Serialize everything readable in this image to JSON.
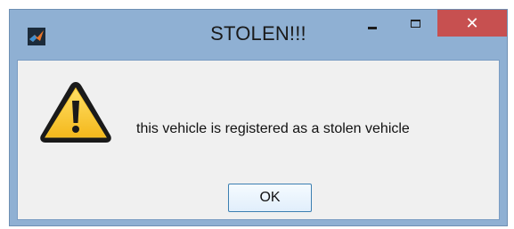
{
  "window": {
    "title": "STOLEN!!!",
    "app_icon": "matlab-icon"
  },
  "title_buttons": {
    "minimize_icon": "minimize-icon",
    "maximize_icon": "maximize-icon",
    "close_label": "✕"
  },
  "dialog": {
    "icon": "warning-icon",
    "message": "this vehicle is registered as a stolen vehicle",
    "ok_label": "OK"
  },
  "colors": {
    "frame": "#8fb0d3",
    "close_button": "#c75050",
    "client_background": "#f0f0f0",
    "warning_yellow": "#f7c62f"
  }
}
